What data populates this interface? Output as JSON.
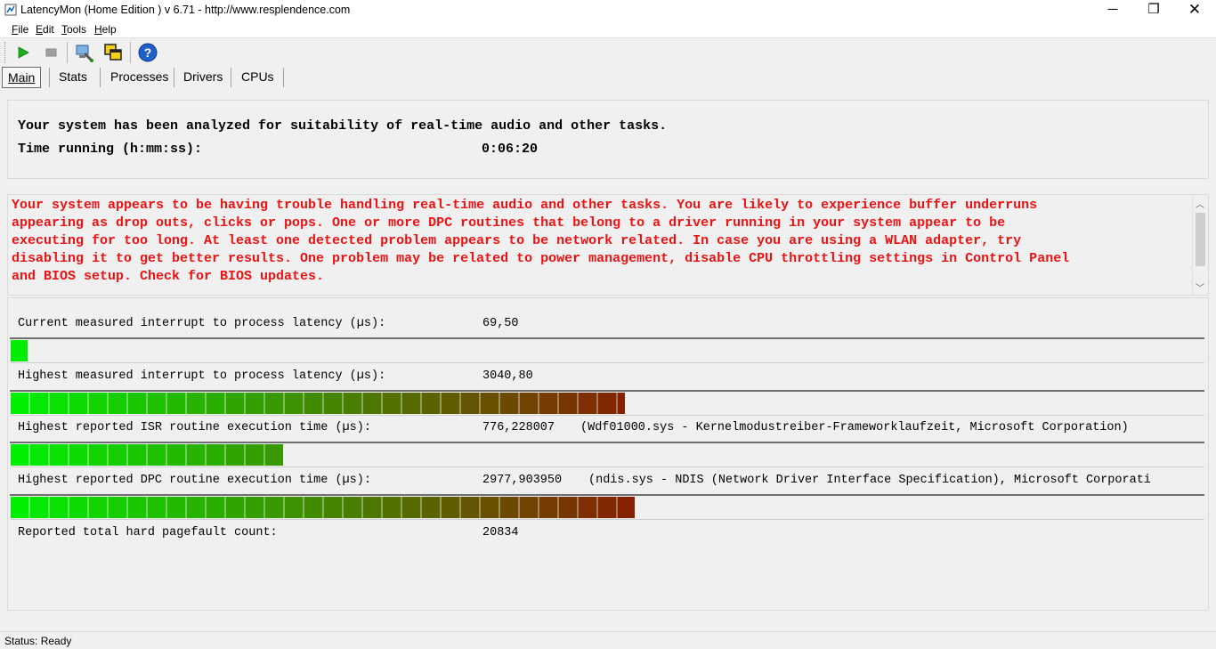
{
  "window": {
    "title": "LatencyMon  (Home Edition )  v 6.71 - http://www.resplendence.com",
    "minimize": "─",
    "maximize": "❐",
    "close": "✕"
  },
  "menu": [
    {
      "label": "File",
      "accel": "F",
      "rest": "ile"
    },
    {
      "label": "Edit",
      "accel": "E",
      "rest": "dit"
    },
    {
      "label": "Tools",
      "accel": "T",
      "rest": "ools"
    },
    {
      "label": "Help",
      "accel": "H",
      "rest": "elp"
    }
  ],
  "toolbar": {
    "icons": [
      "play-icon",
      "stop-icon",
      "computer-wrench-icon",
      "windows-icon",
      "help-icon"
    ],
    "help_glyph": "?"
  },
  "tabs": [
    {
      "label": "Main",
      "active": true
    },
    {
      "label": "Stats",
      "active": false
    },
    {
      "label": "Processes",
      "active": false
    },
    {
      "label": "Drivers",
      "active": false
    },
    {
      "label": "CPUs",
      "active": false
    }
  ],
  "summary": {
    "line1": "Your system has been analyzed for suitability of real-time audio and other tasks.",
    "line2_label": "Time running (h:mm:ss):",
    "line2_value": "0:06:20"
  },
  "warning": {
    "text": "Your system appears to be having trouble handling real-time audio and other tasks. You are likely to experience buffer underruns\nappearing as drop outs, clicks or pops. One or more DPC routines that belong to a driver running in your system appear to be\nexecuting for too long. At least one detected problem appears to be network related. In case you are using a WLAN adapter, try\ndisabling it to get better results. One problem may be related to power management, disable CPU throttling settings in Control Panel\nand BIOS setup. Check for BIOS updates.",
    "color": "#ee1111"
  },
  "measurements": [
    {
      "label": "Current measured interrupt to process latency (µs):",
      "value": "69,50",
      "detail": "",
      "fill_fraction": 0.014
    },
    {
      "label": "Highest measured interrupt to process latency (µs):",
      "value": "3040,80",
      "detail": "",
      "fill_fraction": 0.515
    },
    {
      "label": "Highest reported ISR routine execution time (µs):",
      "value": "776,228007",
      "detail": "(Wdf01000.sys - Kernelmodustreiber-Frameworklaufzeit, Microsoft Corporation)",
      "fill_fraction": 0.228
    },
    {
      "label": "Highest reported DPC routine execution time (µs):",
      "value": "2977,903950",
      "detail": "(ndis.sys - NDIS (Network Driver Interface Specification), Microsoft Corporati",
      "fill_fraction": 0.523
    },
    {
      "label": "Reported total hard pagefault count:",
      "value": "20834",
      "detail": ""
    }
  ],
  "bar_colors": {
    "start": "#00ee00",
    "end": "#8b1a00"
  },
  "status": {
    "text": "Status: Ready"
  }
}
